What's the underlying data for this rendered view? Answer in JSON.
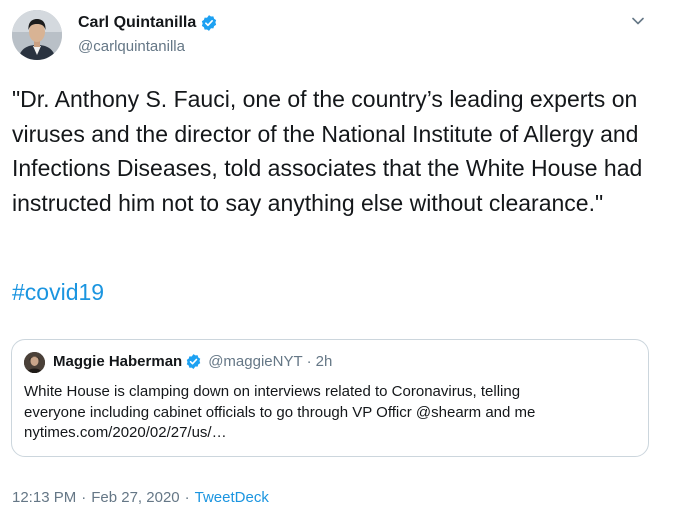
{
  "author": {
    "name": "Carl Quintanilla",
    "handle": "@carlquintanilla",
    "verified": true
  },
  "tweet": {
    "text": "\"Dr. Anthony S. Fauci, one of the country’s leading experts on viruses and the director of the National Institute of Allergy and Infections Diseases, told associates that the White House had instructed him not to say anything else without clearance.\"",
    "hashtag": "#covid19"
  },
  "quoted_tweet": {
    "name": "Maggie Haberman",
    "handle": "@maggieNYT",
    "separator": "·",
    "time": "2h",
    "text_lines": [
      "White House is clamping down on interviews related to Coronavirus, telling",
      "everyone including cabinet officials to go through VP Officr @shearm and me",
      "nytimes.com/2020/02/27/us/…"
    ]
  },
  "meta": {
    "time": "12:13 PM",
    "date": "Feb 27, 2020",
    "separator": "·",
    "source": "TweetDeck"
  },
  "colors": {
    "link": "#1b95e0",
    "secondary_text": "#657786",
    "verified_badge": "#1da1f2",
    "border": "#ccd6dd"
  },
  "icons": {
    "verified": "verified-badge-icon",
    "caret": "chevron-down-icon"
  }
}
